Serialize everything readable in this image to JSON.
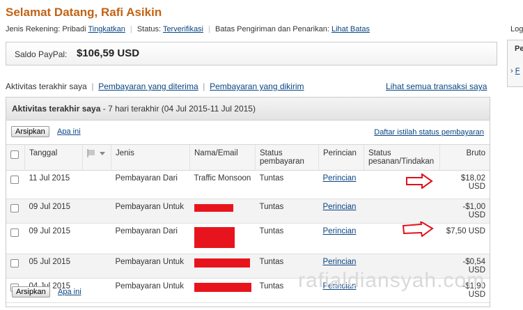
{
  "header": {
    "greeting": "Selamat Datang, Rafi Asikin",
    "account_type_label": "Jenis Rekening: Pribadi",
    "upgrade_link": "Tingkatkan",
    "status_label": "Status:",
    "status_link": "Terverifikasi",
    "limits_label": "Batas Pengiriman dan Penarikan:",
    "limits_link": "Lihat Batas",
    "logout_partial": "Log"
  },
  "balance": {
    "label": "Saldo PayPal:",
    "value": "$106,59 USD"
  },
  "sidebar": {
    "title_partial": "Pe",
    "item_partial": "F"
  },
  "tabs": {
    "recent": "Aktivitas terakhir saya",
    "received": "Pembayaran yang diterima",
    "sent": "Pembayaran yang dikirim",
    "all": "Lihat semua transaksi saya"
  },
  "panel": {
    "title": "Aktivitas terakhir saya",
    "subtitle": "- 7 hari terakhir (04 Jul 2015-11 Jul 2015)",
    "archive_button": "Arsipkan",
    "what_link": "Apa ini",
    "glossary_link": "Daftar istilah status pembayaran"
  },
  "table": {
    "columns": [
      "Tanggal",
      "Jenis",
      "Nama/Email",
      "Status pembayaran",
      "Perincian",
      "Status pesanan/Tindakan",
      "Bruto"
    ],
    "rows": [
      {
        "date": "11 Jul 2015",
        "type": "Pembayaran Dari",
        "name": "Traffic Monsoon",
        "status": "Tuntas",
        "details": "Perincian",
        "order_status": "",
        "gross": "$18,02 USD"
      },
      {
        "date": "09 Jul 2015",
        "type": "Pembayaran Untuk",
        "name": "",
        "status": "Tuntas",
        "details": "Perincian",
        "order_status": "",
        "gross": "-$1,00 USD"
      },
      {
        "date": "09 Jul 2015",
        "type": "Pembayaran Dari",
        "name": "",
        "status": "Tuntas",
        "details": "Perincian",
        "order_status": "",
        "gross": "$7,50 USD"
      },
      {
        "date": "05 Jul 2015",
        "type": "Pembayaran Untuk",
        "name": "",
        "status": "Tuntas",
        "details": "Perincian",
        "order_status": "",
        "gross": "-$0,54 USD"
      },
      {
        "date": "04 Jul 2015",
        "type": "Pembayaran Untuk",
        "name": "",
        "status": "Tuntas",
        "details": "Perincian",
        "order_status": "",
        "gross": "-$1,90 USD"
      }
    ]
  },
  "watermark": "rafialdiansyah.com",
  "colors": {
    "accent": "#c06316",
    "link": "#084482",
    "redaction": "#e8141d",
    "arrow": "#e0101a"
  }
}
